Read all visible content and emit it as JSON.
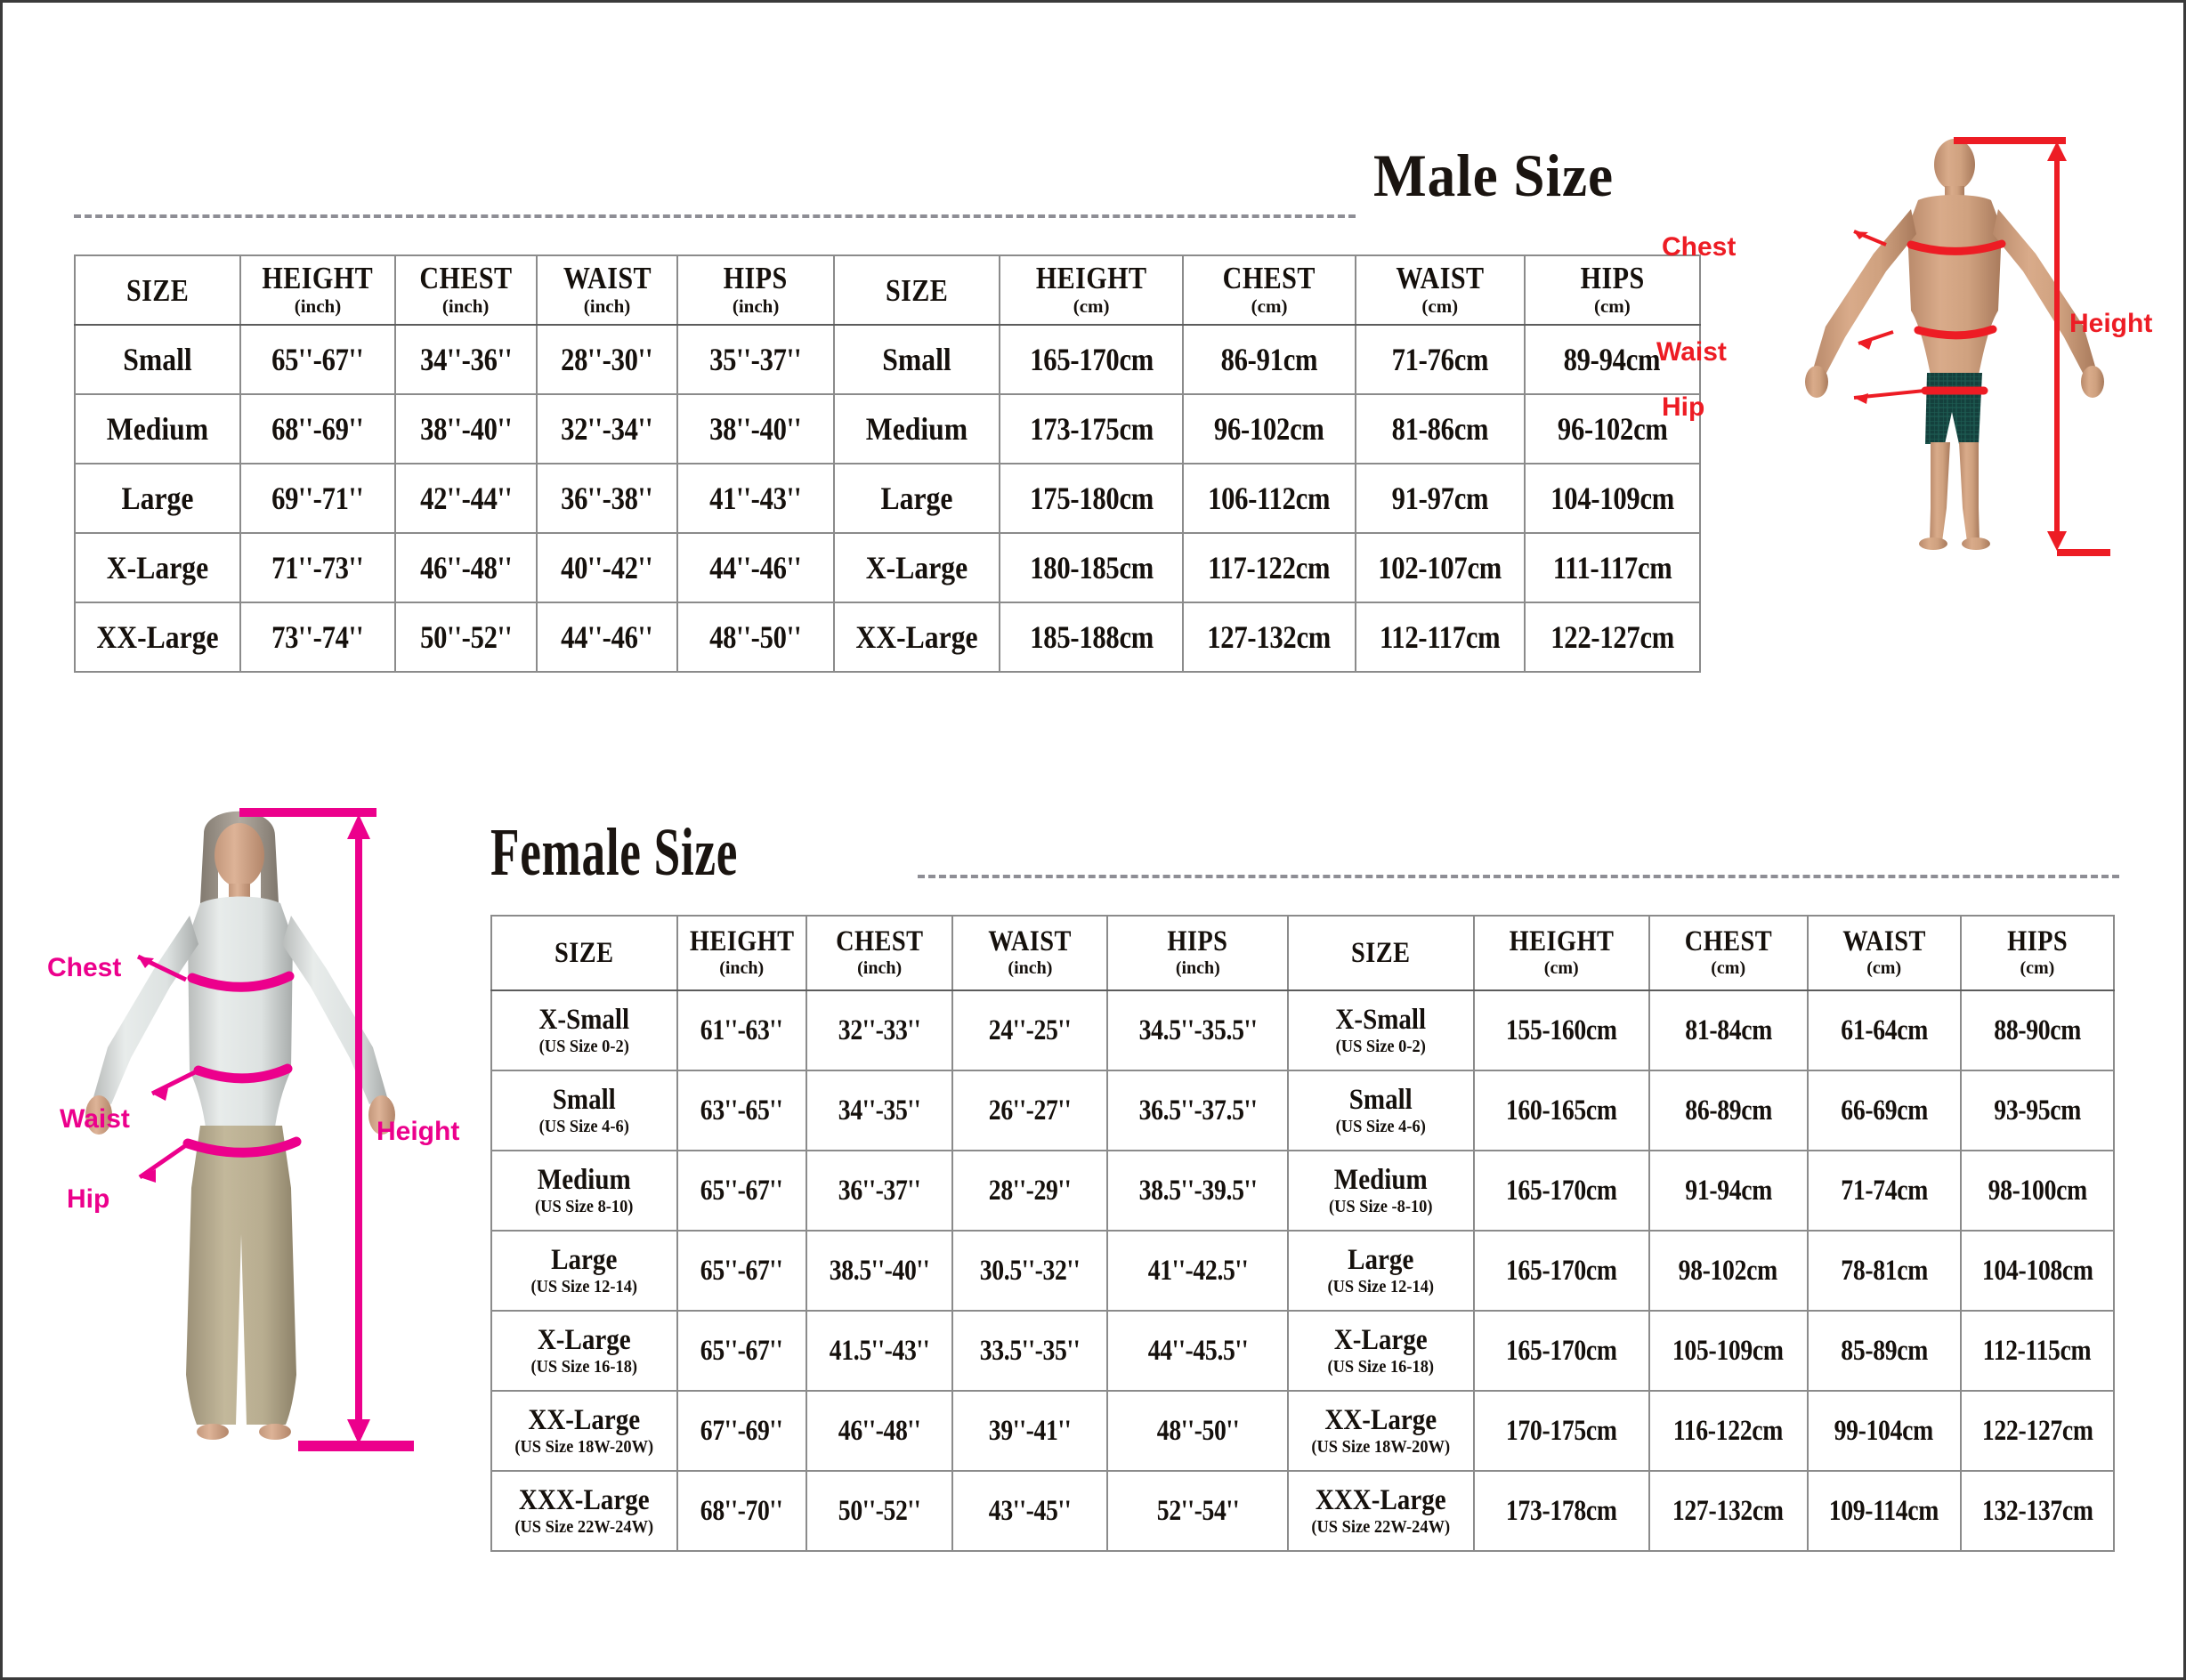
{
  "male": {
    "title": "Male Size",
    "headers_inch": [
      {
        "name": "SIZE",
        "unit": ""
      },
      {
        "name": "HEIGHT",
        "unit": "(inch)"
      },
      {
        "name": "CHEST",
        "unit": "(inch)"
      },
      {
        "name": "WAIST",
        "unit": "(inch)"
      },
      {
        "name": "HIPS",
        "unit": "(inch)"
      }
    ],
    "headers_cm": [
      {
        "name": "SIZE",
        "unit": ""
      },
      {
        "name": "HEIGHT",
        "unit": "(cm)"
      },
      {
        "name": "CHEST",
        "unit": "(cm)"
      },
      {
        "name": "WAIST",
        "unit": "(cm)"
      },
      {
        "name": "HIPS",
        "unit": "(cm)"
      }
    ],
    "rows": [
      {
        "size_in": "Small",
        "height_in": "65''-67''",
        "chest_in": "34''-36''",
        "waist_in": "28''-30''",
        "hips_in": "35''-37''",
        "size_cm": "Small",
        "height_cm": "165-170cm",
        "chest_cm": "86-91cm",
        "waist_cm": "71-76cm",
        "hips_cm": "89-94cm"
      },
      {
        "size_in": "Medium",
        "height_in": "68''-69''",
        "chest_in": "38''-40''",
        "waist_in": "32''-34''",
        "hips_in": "38''-40''",
        "size_cm": "Medium",
        "height_cm": "173-175cm",
        "chest_cm": "96-102cm",
        "waist_cm": "81-86cm",
        "hips_cm": "96-102cm"
      },
      {
        "size_in": "Large",
        "height_in": "69''-71''",
        "chest_in": "42''-44''",
        "waist_in": "36''-38''",
        "hips_in": "41''-43''",
        "size_cm": "Large",
        "height_cm": "175-180cm",
        "chest_cm": "106-112cm",
        "waist_cm": "91-97cm",
        "hips_cm": "104-109cm"
      },
      {
        "size_in": "X-Large",
        "height_in": "71''-73''",
        "chest_in": "46''-48''",
        "waist_in": "40''-42''",
        "hips_in": "44''-46''",
        "size_cm": "X-Large",
        "height_cm": "180-185cm",
        "chest_cm": "117-122cm",
        "waist_cm": "102-107cm",
        "hips_cm": "111-117cm"
      },
      {
        "size_in": "XX-Large",
        "height_in": "73''-74''",
        "chest_in": "50''-52''",
        "waist_in": "44''-46''",
        "hips_in": "48''-50''",
        "size_cm": "XX-Large",
        "height_cm": "185-188cm",
        "chest_cm": "127-132cm",
        "waist_cm": "112-117cm",
        "hips_cm": "122-127cm"
      }
    ],
    "figure_labels": {
      "chest": "Chest",
      "waist": "Waist",
      "hip": "Hip",
      "height": "Height"
    },
    "accent_color": "#ed1c24"
  },
  "female": {
    "title": "Female Size",
    "headers_inch": [
      {
        "name": "SIZE",
        "unit": ""
      },
      {
        "name": "HEIGHT",
        "unit": "(inch)"
      },
      {
        "name": "CHEST",
        "unit": "(inch)"
      },
      {
        "name": "WAIST",
        "unit": "(inch)"
      },
      {
        "name": "HIPS",
        "unit": "(inch)"
      }
    ],
    "headers_cm": [
      {
        "name": "SIZE",
        "unit": ""
      },
      {
        "name": "HEIGHT",
        "unit": "(cm)"
      },
      {
        "name": "CHEST",
        "unit": "(cm)"
      },
      {
        "name": "WAIST",
        "unit": "(cm)"
      },
      {
        "name": "HIPS",
        "unit": "(cm)"
      }
    ],
    "rows": [
      {
        "size_in": "X-Small",
        "us_in": "(US Size 0-2)",
        "height_in": "61''-63''",
        "chest_in": "32''-33''",
        "waist_in": "24''-25''",
        "hips_in": "34.5''-35.5''",
        "size_cm": "X-Small",
        "us_cm": "(US Size 0-2)",
        "height_cm": "155-160cm",
        "chest_cm": "81-84cm",
        "waist_cm": "61-64cm",
        "hips_cm": "88-90cm"
      },
      {
        "size_in": "Small",
        "us_in": "(US Size 4-6)",
        "height_in": "63''-65''",
        "chest_in": "34''-35''",
        "waist_in": "26''-27''",
        "hips_in": "36.5''-37.5''",
        "size_cm": "Small",
        "us_cm": "(US Size 4-6)",
        "height_cm": "160-165cm",
        "chest_cm": "86-89cm",
        "waist_cm": "66-69cm",
        "hips_cm": "93-95cm"
      },
      {
        "size_in": "Medium",
        "us_in": "(US Size 8-10)",
        "height_in": "65''-67''",
        "chest_in": "36''-37''",
        "waist_in": "28''-29''",
        "hips_in": "38.5''-39.5''",
        "size_cm": "Medium",
        "us_cm": "(US Size -8-10)",
        "height_cm": "165-170cm",
        "chest_cm": "91-94cm",
        "waist_cm": "71-74cm",
        "hips_cm": "98-100cm"
      },
      {
        "size_in": "Large",
        "us_in": "(US Size 12-14)",
        "height_in": "65''-67''",
        "chest_in": "38.5''-40''",
        "waist_in": "30.5''-32''",
        "hips_in": "41''-42.5''",
        "size_cm": "Large",
        "us_cm": "(US Size 12-14)",
        "height_cm": "165-170cm",
        "chest_cm": "98-102cm",
        "waist_cm": "78-81cm",
        "hips_cm": "104-108cm"
      },
      {
        "size_in": "X-Large",
        "us_in": "(US Size 16-18)",
        "height_in": "65''-67''",
        "chest_in": "41.5''-43''",
        "waist_in": "33.5''-35''",
        "hips_in": "44''-45.5''",
        "size_cm": "X-Large",
        "us_cm": "(US Size 16-18)",
        "height_cm": "165-170cm",
        "chest_cm": "105-109cm",
        "waist_cm": "85-89cm",
        "hips_cm": "112-115cm"
      },
      {
        "size_in": "XX-Large",
        "us_in": "(US Size 18W-20W)",
        "height_in": "67''-69''",
        "chest_in": "46''-48''",
        "waist_in": "39''-41''",
        "hips_in": "48''-50''",
        "size_cm": "XX-Large",
        "us_cm": "(US Size 18W-20W)",
        "height_cm": "170-175cm",
        "chest_cm": "116-122cm",
        "waist_cm": "99-104cm",
        "hips_cm": "122-127cm"
      },
      {
        "size_in": "XXX-Large",
        "us_in": "(US Size 22W-24W)",
        "height_in": "68''-70''",
        "chest_in": "50''-52''",
        "waist_in": "43''-45''",
        "hips_in": "52''-54''",
        "size_cm": "XXX-Large",
        "us_cm": "(US Size 22W-24W)",
        "height_cm": "173-178cm",
        "chest_cm": "127-132cm",
        "waist_cm": "109-114cm",
        "hips_cm": "132-137cm"
      }
    ],
    "figure_labels": {
      "chest": "Chest",
      "waist": "Waist",
      "hip": "Hip",
      "height": "Height"
    },
    "accent_color": "#ec008c"
  }
}
